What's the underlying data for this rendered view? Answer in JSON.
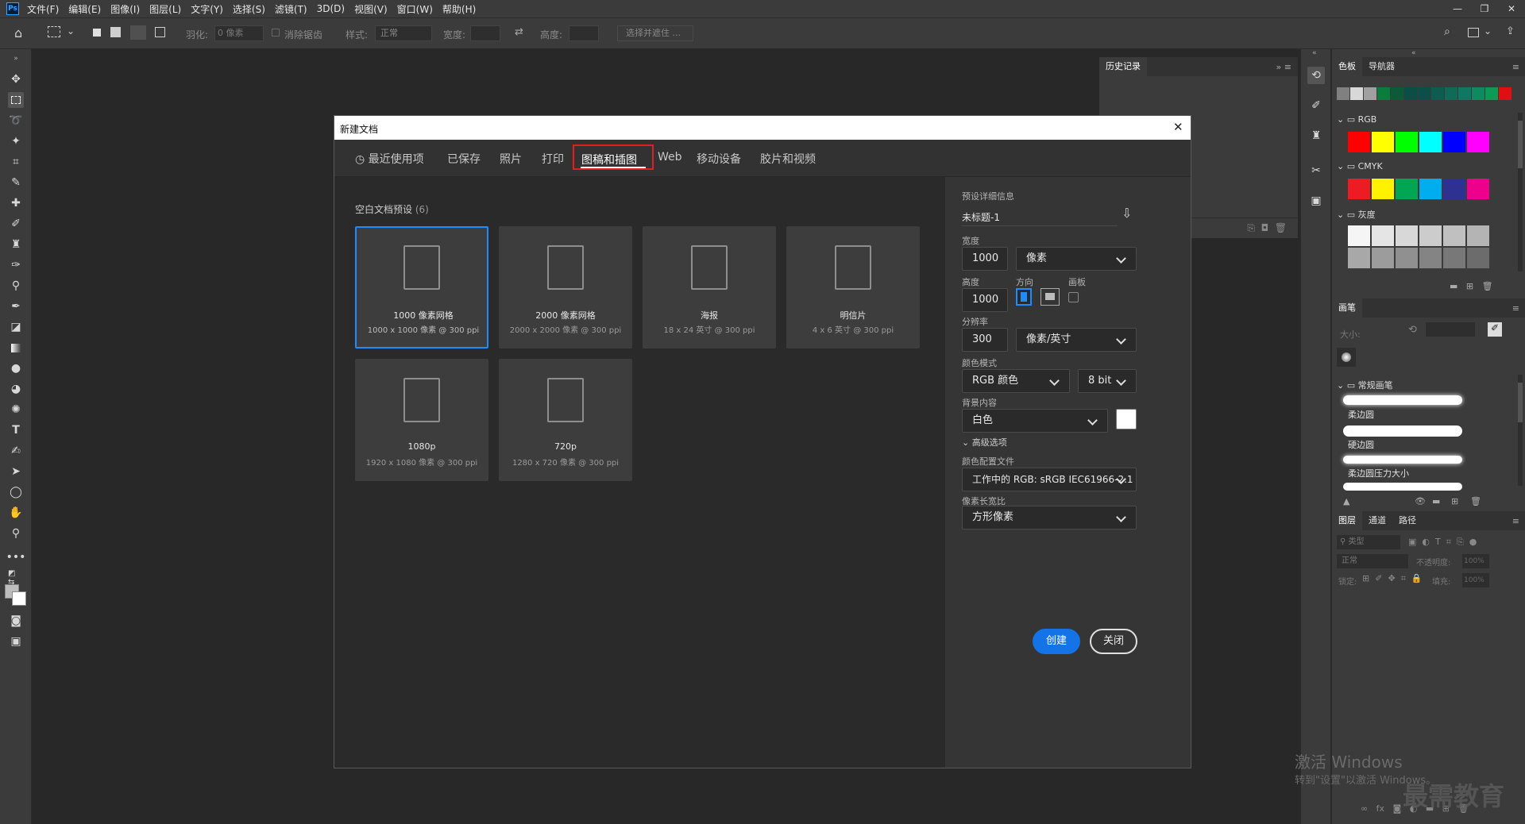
{
  "menubar": {
    "logo": "Ps",
    "items": [
      "文件(F)",
      "编辑(E)",
      "图像(I)",
      "图层(L)",
      "文字(Y)",
      "选择(S)",
      "滤镜(T)",
      "3D(D)",
      "视图(V)",
      "窗口(W)",
      "帮助(H)"
    ],
    "win_controls": [
      "—",
      "❐",
      "✕"
    ]
  },
  "options": {
    "feather_label": "羽化:",
    "feather_value": "0 像素",
    "antialias_label": "消除锯齿",
    "style_label": "样式:",
    "style_value": "正常",
    "width_label": "宽度:",
    "height_label": "高度:",
    "select_mask_label": "选择并遮住 ..."
  },
  "history_panel": {
    "tab": "历史记录"
  },
  "swatches_panel": {
    "tabs": [
      "色板",
      "导航器"
    ],
    "folder_rgb": "RGB",
    "folder_cmyk": "CMYK",
    "folder_gray": "灰度",
    "recent_colors": [
      "#808080",
      "#d8d8d8",
      "#a0a0a0",
      "#0a7c3c",
      "#0b5a38",
      "#0b4e46",
      "#0c4f4a",
      "#0d5c50",
      "#0f6a58",
      "#0e7862",
      "#0d8a5e",
      "#0c9a55",
      "#e01010"
    ],
    "rgb_colors": [
      "#ff0000",
      "#ffff00",
      "#00ff00",
      "#00ffff",
      "#0000ff",
      "#ff00ff"
    ],
    "cmyk_colors": [
      "#ed1c24",
      "#fff200",
      "#00a651",
      "#00aeef",
      "#2e3192",
      "#ec008c"
    ],
    "gray_colors": [
      "#f5f5f5",
      "#e5e5e5",
      "#d8d8d8",
      "#cccccc",
      "#c0c0c0",
      "#b4b4b4",
      "#a8a8a8",
      "#9c9c9c",
      "#909090",
      "#848484",
      "#787878",
      "#6c6c6c"
    ]
  },
  "brushes_panel": {
    "tab": "画笔",
    "size_label": "大小:",
    "folder": "常规画笔",
    "brushes": [
      "柔边圆",
      "硬边圆",
      "柔边圆压力大小"
    ]
  },
  "layers_panel": {
    "tabs": [
      "图层",
      "通道",
      "路径"
    ],
    "kind_label": "类型",
    "blend_mode": "正常",
    "opacity_label": "不透明度:",
    "opacity_value": "100%",
    "lock_label": "锁定:",
    "fill_label": "填充:",
    "fill_value": "100%"
  },
  "dialog": {
    "title": "新建文档",
    "close": "✕",
    "tabs": [
      "最近使用项",
      "已保存",
      "照片",
      "打印",
      "图稿和插图",
      "Web",
      "移动设备",
      "胶片和视频"
    ],
    "active_tab": "图稿和插图",
    "section_title": "空白文档预设",
    "section_count": "(6)",
    "presets": [
      {
        "name": "1000 像素网格",
        "size": "1000 x 1000 像素 @ 300 ppi"
      },
      {
        "name": "2000 像素网格",
        "size": "2000 x 2000 像素 @ 300 ppi"
      },
      {
        "name": "海报",
        "size": "18 x 24 英寸 @ 300 ppi"
      },
      {
        "name": "明信片",
        "size": "4 x 6 英寸 @ 300 ppi"
      },
      {
        "name": "1080p",
        "size": "1920 x 1080 像素 @ 300 ppi"
      },
      {
        "name": "720p",
        "size": "1280 x 720 像素 @ 300 ppi"
      }
    ],
    "details": {
      "header": "预设详细信息",
      "doc_name": "未标题-1",
      "width_label": "宽度",
      "width_value": "1000",
      "width_unit": "像素",
      "height_label": "高度",
      "height_value": "1000",
      "orientation_label": "方向",
      "artboard_label": "画板",
      "resolution_label": "分辨率",
      "resolution_value": "300",
      "resolution_unit": "像素/英寸",
      "color_mode_label": "颜色模式",
      "color_mode_value": "RGB 颜色",
      "bit_depth": "8 bit",
      "background_label": "背景内容",
      "background_value": "白色",
      "background_color": "#ffffff",
      "advanced_label": "高级选项",
      "color_profile_label": "颜色配置文件",
      "color_profile_value": "工作中的 RGB: sRGB IEC61966-2.1",
      "pixel_aspect_label": "像素长宽比",
      "pixel_aspect_value": "方形像素",
      "create_label": "创建",
      "close_label": "关闭"
    }
  },
  "watermark": {
    "activate_line1": "激活 Windows",
    "activate_line2": "转到\"设置\"以激活 Windows。",
    "brand": "最需教育"
  },
  "colors": {
    "accent": "#1473e6",
    "select_border": "#1e8cff",
    "highlight": "#e02020"
  }
}
